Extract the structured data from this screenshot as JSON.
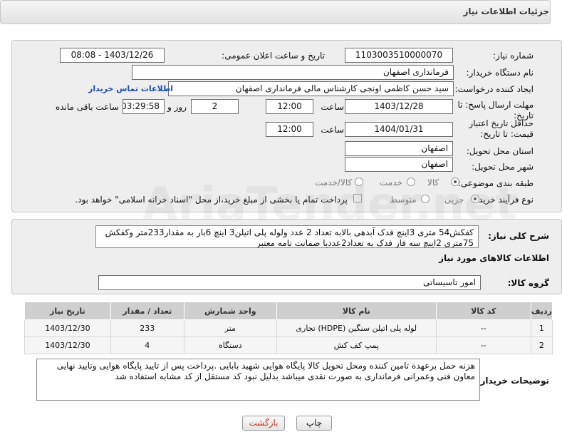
{
  "header": {
    "title": "جزئیات اطلاعات نیاز"
  },
  "form": {
    "need_number_label": "شماره نیاز:",
    "need_number": "1103003510000070",
    "announce_label": "تاریخ و ساعت اعلان عمومی:",
    "announce_value": "1403/12/26 - 08:08",
    "buyer_org_label": "نام دستگاه خریدار:",
    "buyer_org": "فرمانداری اصفهان",
    "creator_label": "ایجاد کننده درخواست:",
    "creator": "سید حسن  کاظمی اونجی کارشناس مالی  فرمانداری اصفهان",
    "contact_link": "اطلاعات تماس خریدار",
    "send_deadline_label": "مهلت ارسال پاسخ: تا تاریخ:",
    "send_deadline_date": "1403/12/28",
    "time_label": "ساعت",
    "send_deadline_time": "12:00",
    "days_value": "2",
    "days_label": "روز و",
    "remaining_time": "03:29:58",
    "remaining_label": "ساعت باقی مانده",
    "price_validity_label": "حداقل تاریخ اعتبار قیمت: تا تاریخ:",
    "price_validity_date": "1404/01/31",
    "price_validity_time": "12:00",
    "province_label": "استان محل تحویل:",
    "province": "اصفهان",
    "city_label": "شهر محل تحویل:",
    "city": "اصفهان",
    "category_label": "طبقه بندی موضوعی:",
    "category_options": [
      "کالا",
      "خدمت",
      "کالا/خدمت"
    ],
    "category_selected": "کالا",
    "process_label": "نوع فرآیند خرید :",
    "process_options": [
      "جزیی",
      "متوسط"
    ],
    "process_selected": "جزیی",
    "payment_note": "پرداخت تمام یا بخشی از مبلغ خرید،از محل \"اسناد خزانه اسلامی\" خواهد بود."
  },
  "description": {
    "label": "شرح کلی نیاز:",
    "text": "کفکش54 متری 3اینچ فدک آبدهی بالابه تعداد 2 عدد ولوله پلی اتیلن3 اینچ 6بار به مقدار233متر وکفکش 75متری 2اینچ سه فاز فدک به تعداد2عددبا ضمانت نامه معتبر"
  },
  "goods_section": {
    "title": "اطلاعات کالاهای مورد نیاز",
    "group_label": "گروه کالا:",
    "group_value": "امور تاسیساتی"
  },
  "table": {
    "headers": [
      "ردیف",
      "کد کالا",
      "نام کالا",
      "واحد شمارش",
      "تعداد / مقدار",
      "تاریخ نیاز"
    ],
    "rows": [
      [
        "1",
        "--",
        "لوله پلی اتیلن سنگین (HDPE) تجاری",
        "متر",
        "233",
        "1403/12/30"
      ],
      [
        "2",
        "--",
        "پمپ کف کش",
        "دستگاه",
        "4",
        "1403/12/30"
      ]
    ]
  },
  "buyer_notes": {
    "label": "توضیحات خریدار:",
    "text": "هزنه حمل برعهدة تامین کننده ومحل تحویل کالا  پایگاه هوایی شهید بابایی .پرداخت پس از تایید پایگاه هوایی وتایید نهایی معاون فنی وعمرانی فرمانداری به صورت نقدی میباشد بدلیل نبود کد مستقل از کد مشابه استفاده شد"
  },
  "buttons": {
    "print": "چاپ",
    "back": "بازگشت"
  },
  "watermark": {
    "text": "AriaTender.net"
  },
  "colors": {
    "link": "#1a4fb8",
    "back_button_text": "#c0392b",
    "panel_bg": "#eeeeee",
    "table_header_bg": "#cfcfcf"
  }
}
